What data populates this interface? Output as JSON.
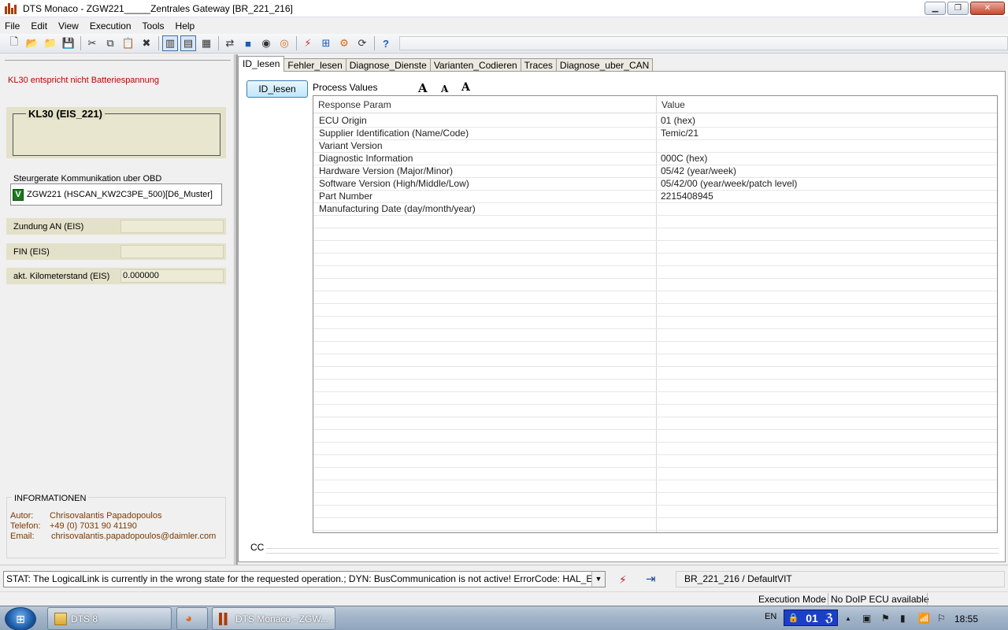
{
  "window": {
    "title": "DTS Monaco  - ZGW221_____Zentrales Gateway [BR_221_216]",
    "minimize_glyph": "▁",
    "maximize_glyph": "❐",
    "close_glyph": "✕"
  },
  "menu": [
    "File",
    "Edit",
    "View",
    "Execution",
    "Tools",
    "Help"
  ],
  "toolbar_icons": [
    {
      "name": "new-file-icon",
      "glyph": "🗋"
    },
    {
      "name": "open-folder-icon",
      "glyph": "📂"
    },
    {
      "name": "open-recent-icon",
      "glyph": "📁"
    },
    {
      "name": "save-icon",
      "glyph": "💾"
    },
    {
      "name": "cut-icon",
      "glyph": "✂"
    },
    {
      "name": "copy-icon",
      "glyph": "⧉"
    },
    {
      "name": "paste-icon",
      "glyph": "📋"
    },
    {
      "name": "delete-icon",
      "glyph": "✖"
    },
    {
      "name": "layout-left-icon",
      "glyph": "▥"
    },
    {
      "name": "layout-split-icon",
      "glyph": "▤"
    },
    {
      "name": "layout-columns-icon",
      "glyph": "▦"
    },
    {
      "name": "connect-icon",
      "glyph": "⇄"
    },
    {
      "name": "stop-icon",
      "glyph": "■"
    },
    {
      "name": "record-icon",
      "glyph": "◉"
    },
    {
      "name": "target-icon",
      "glyph": "◎"
    },
    {
      "name": "link-icon",
      "glyph": "⚡"
    },
    {
      "name": "network-icon",
      "glyph": "⊞"
    },
    {
      "name": "settings-icon",
      "glyph": "⚙"
    },
    {
      "name": "flash-icon",
      "glyph": "⟳"
    },
    {
      "name": "help-icon",
      "glyph": "?"
    }
  ],
  "left": {
    "kl30_warning": "KL30 entspricht nicht Batteriespannung",
    "kl30_title": "KL30 (EIS_221)",
    "obd_label": "Steurgerate Kommunikation uber OBD",
    "obd_badge": "V",
    "obd_value": "ZGW221 (HSCAN_KW2C3PE_500)[D6_Muster]",
    "fields": [
      {
        "label": "Zundung AN (EIS)",
        "value": ""
      },
      {
        "label": "FIN  (EIS)",
        "value": ""
      },
      {
        "label": "akt. Kilometerstand (EIS)",
        "value": "0.000000"
      }
    ],
    "info": {
      "title": "INFORMATIONEN",
      "author_key": "Autor:",
      "author_val": "Chrisovalantis Papadopoulos",
      "phone_key": "Telefon:",
      "phone_val": "+49 (0) 7031 90 41190",
      "email_key": "Email:",
      "email_val": "chrisovalantis.papadopoulos@daimler.com"
    }
  },
  "tabs": [
    "ID_lesen",
    "Fehler_lesen",
    "Diagnose_Dienste",
    "Varianten_Codieren",
    "Traces",
    "Diagnose_uber_CAN"
  ],
  "active_tab": "ID_lesen",
  "main": {
    "button_label": "ID_lesen",
    "process_values_label": "Process Values",
    "font_buttons": [
      "A",
      "A",
      "A"
    ],
    "columns": [
      "Response Param",
      "Value"
    ],
    "rows": [
      [
        "ECU Origin",
        "01 (hex)"
      ],
      [
        "Supplier Identification (Name/Code)",
        "Temic/21"
      ],
      [
        "Variant Version",
        ""
      ],
      [
        "Diagnostic Information",
        "000C (hex)"
      ],
      [
        "Hardware Version (Major/Minor)",
        "05/42 (year/week)"
      ],
      [
        "Software Version (High/Middle/Low)",
        "05/42/00 (year/week/patch level)"
      ],
      [
        "Part Number",
        "2215408945"
      ],
      [
        "Manufacturing Date (day/month/year)",
        ""
      ]
    ],
    "cc_label": "CC"
  },
  "status": {
    "message": "STAT: The LogicalLink is currently in the wrong state for the requested operation.; DYN: BusCommunication is not active! ErrorCode: HAL_ERROR_WRONG",
    "vit": "BR_221_216 / DefaultVIT",
    "execution_mode": "Execution Mode",
    "doip": "No DoIP ECU available"
  },
  "taskbar": {
    "start_glyph": "⊞",
    "items": [
      "DTS 8",
      "DTS Monaco  - ZGW..."
    ],
    "firefox_glyph": "◕",
    "lang": "EN",
    "kb_lock_glyph": "🔒",
    "kb_label": "01",
    "kb_glyph": "ℨ",
    "tray": [
      "▲",
      "▣",
      "⚑",
      "▮",
      "📶",
      "⚐"
    ],
    "time": "18:55"
  }
}
